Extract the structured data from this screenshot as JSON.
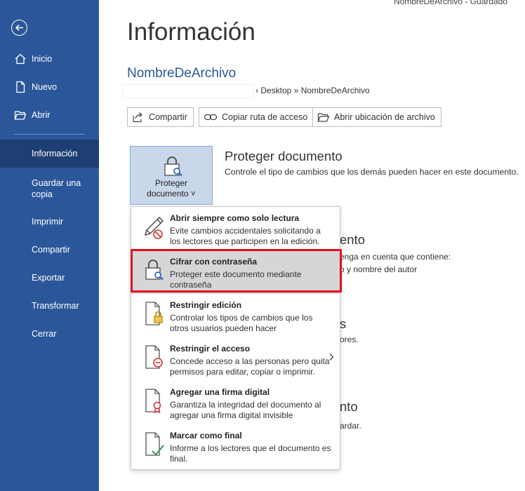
{
  "top_remnant": "NombreDeArchivo  -  Guardado",
  "sidebar": {
    "items": [
      {
        "label": "Inicio"
      },
      {
        "label": "Nuevo"
      },
      {
        "label": "Abrir"
      },
      {
        "label": "Información"
      },
      {
        "label": "Guardar una copia"
      },
      {
        "label": "Imprimir"
      },
      {
        "label": "Compartir"
      },
      {
        "label": "Exportar"
      },
      {
        "label": "Transformar"
      },
      {
        "label": "Cerrar"
      }
    ]
  },
  "main": {
    "title": "Información",
    "file_name": "NombreDeArchivo",
    "path": "› Desktop » NombreDeArchivo",
    "buttons": {
      "share": "Compartir",
      "copy_path": "Copiar ruta de acceso",
      "open_location": "Abrir ubicación de archivo"
    },
    "protect": {
      "tile_label_1": "Proteger",
      "tile_label_2": "documento ˅",
      "heading": "Proteger documento",
      "description": "Controle el tipo de cambios que los demás pueden hacer en este documento."
    },
    "background_fragments": {
      "heading_2": "ento",
      "line_2a": "enga en cuenta que contiene:",
      "line_2b": "o y nombre del autor",
      "heading_3": "s",
      "line_3": "ores.",
      "heading_4": "nto",
      "line_4": "ardar."
    }
  },
  "dropdown": {
    "items": [
      {
        "title": "Abrir siempre como solo lectura",
        "desc": "Evite cambios accidentales solicitando a los lectores que participen en la edición."
      },
      {
        "title": "Cifrar con contraseña",
        "desc": "Proteger este documento mediante contraseña"
      },
      {
        "title": "Restringir edición",
        "desc": "Controlar los tipos de cambios que los otros usuarios pueden hacer"
      },
      {
        "title": "Restringir el acceso",
        "desc": "Concede acceso a las personas pero quita permisos para editar, copiar o imprimir."
      },
      {
        "title": "Agregar una firma digital",
        "desc": "Garantiza la integridad del documento al agregar una firma digital invisible"
      },
      {
        "title": "Marcar como final",
        "desc": "Informe a los lectores que el documento es final."
      }
    ]
  },
  "colors": {
    "sidebar": "#2b579a",
    "sidebar_active": "#1e3f73",
    "accent": "#2b579a",
    "highlight_border": "#e0101f"
  }
}
